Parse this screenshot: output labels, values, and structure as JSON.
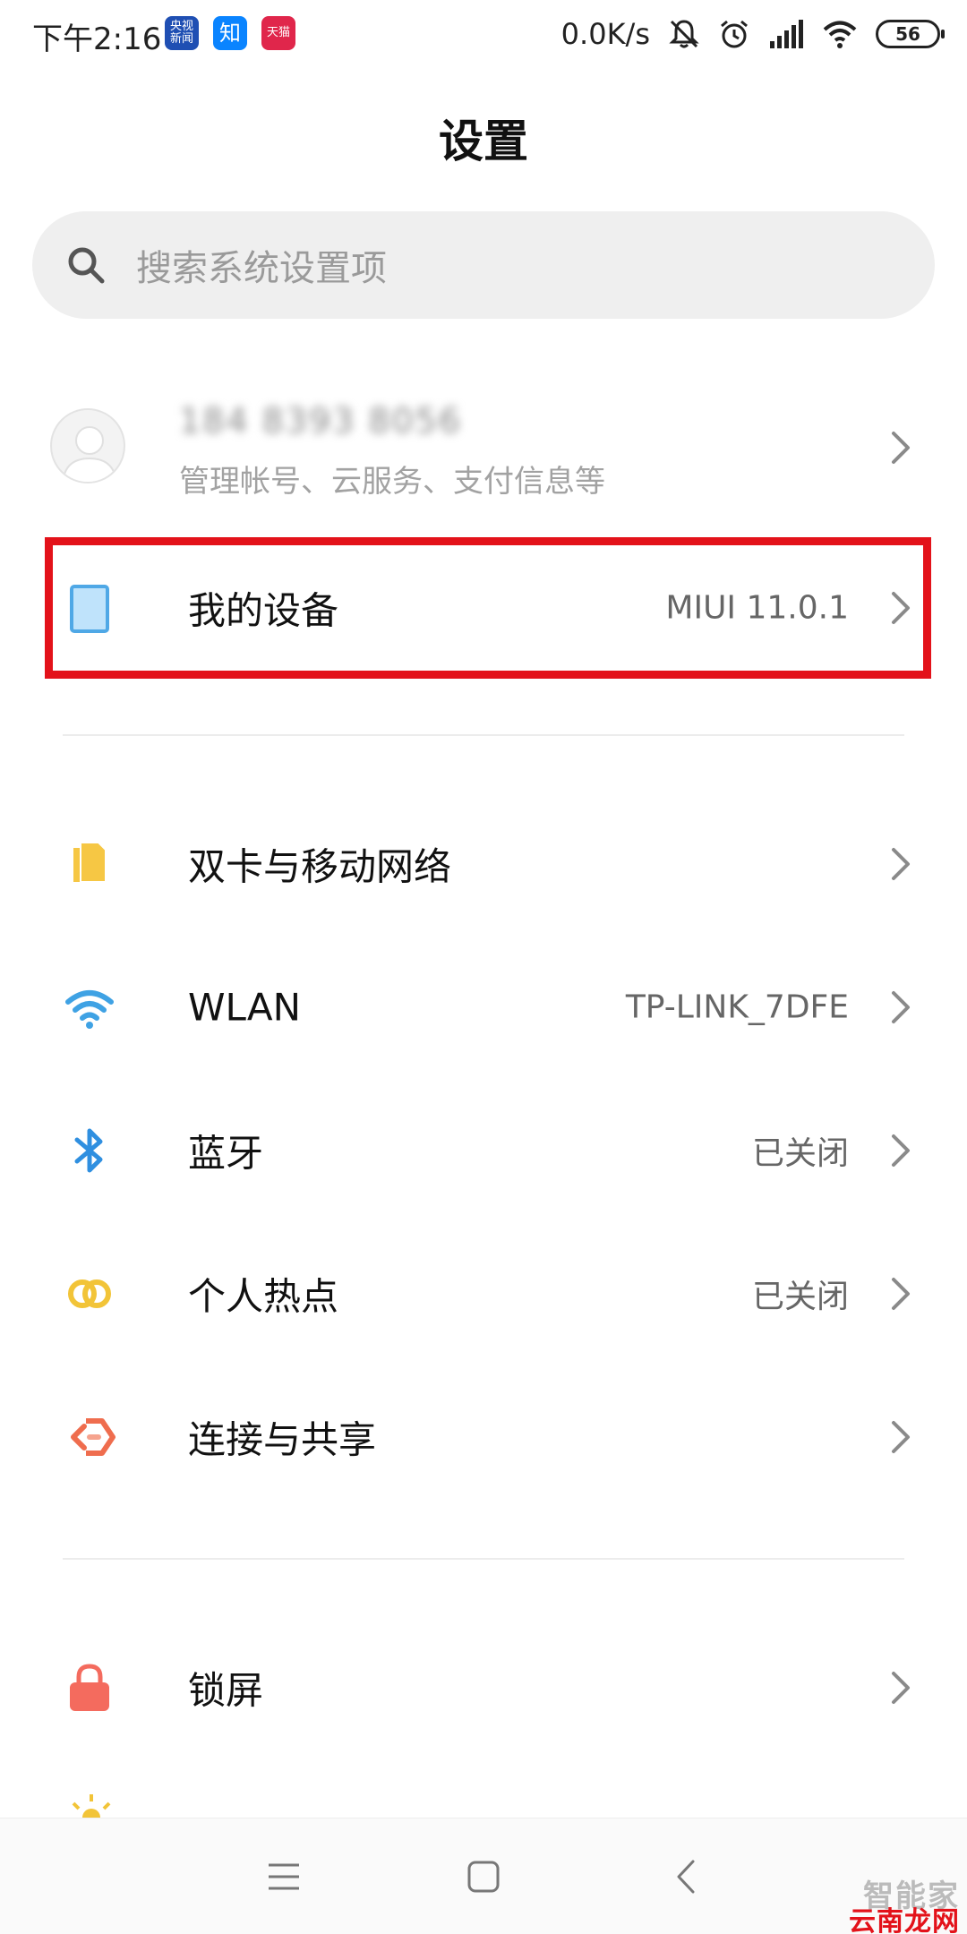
{
  "status_bar": {
    "time": "下午2:16",
    "notification_apps": [
      {
        "label": "央视新闻",
        "color": "#1f4fb3"
      },
      {
        "label": "知",
        "color": "#0a84ff"
      },
      {
        "label": "天猫",
        "color": "#e0264b"
      }
    ],
    "net_speed": "0.0K/s",
    "battery": "56"
  },
  "page": {
    "title": "设置"
  },
  "search": {
    "placeholder": "搜索系统设置项"
  },
  "account": {
    "name_masked": "184 8393 8056",
    "subtitle": "管理帐号、云服务、支付信息等"
  },
  "rows": {
    "my_device": {
      "label": "我的设备",
      "value": "MIUI 11.0.1",
      "icon": "tablet-icon",
      "color": "#4fa8e6"
    },
    "dual_sim": {
      "label": "双卡与移动网络",
      "value": "",
      "icon": "sim-card-icon",
      "color": "#f6c744"
    },
    "wlan": {
      "label": "WLAN",
      "value": "TP-LINK_7DFE",
      "icon": "wifi-icon",
      "color": "#3fa2e4"
    },
    "bluetooth": {
      "label": "蓝牙",
      "value": "已关闭",
      "icon": "bluetooth-icon",
      "color": "#2f8fe0"
    },
    "hotspot": {
      "label": "个人热点",
      "value": "已关闭",
      "icon": "hotspot-icon",
      "color": "#f2c438"
    },
    "connect_share": {
      "label": "连接与共享",
      "value": "",
      "icon": "connect-share-icon",
      "color": "#ef6d4e"
    },
    "lock_screen": {
      "label": "锁屏",
      "value": "",
      "icon": "lock-icon",
      "color": "#f46b5e"
    }
  },
  "watermark": {
    "top": "智能家",
    "bottom": "云南龙网"
  }
}
